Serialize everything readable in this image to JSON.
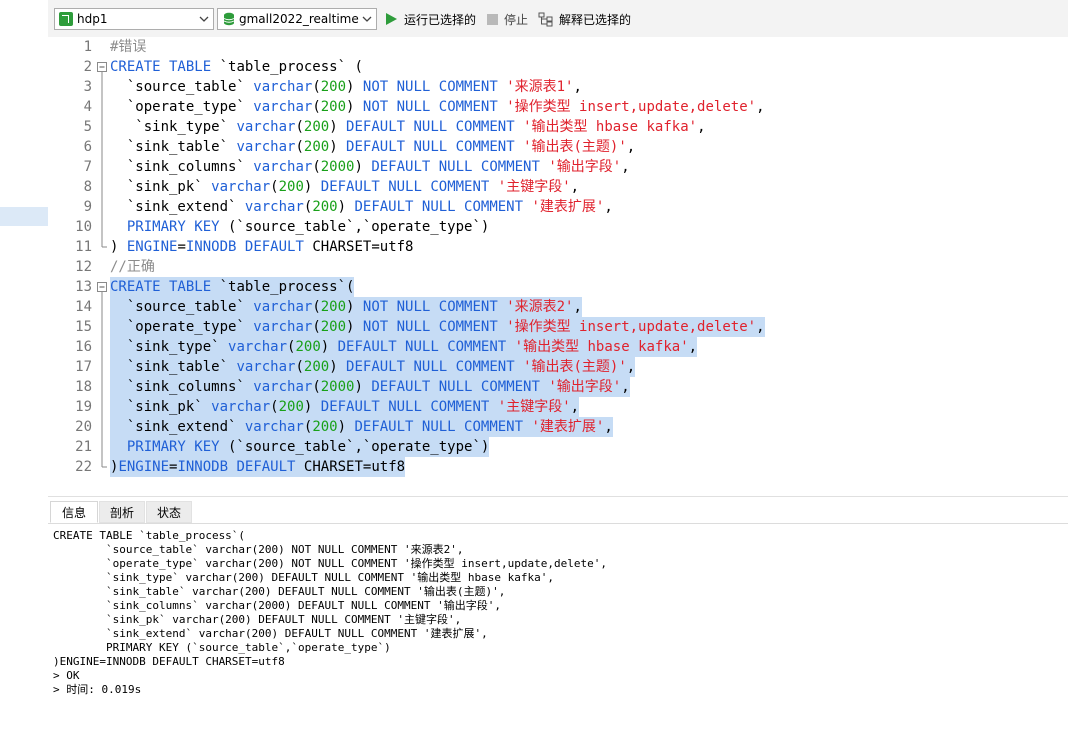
{
  "toolbar": {
    "connection": "hdp1",
    "database": "gmall2022_realtime",
    "run_label": "运行已选择的",
    "stop_label": "停止",
    "explain_label": "解释已选择的",
    "colors": {
      "run": "#2e9c3b",
      "db": "#2e9c3b",
      "connection": "#2e9c3b"
    }
  },
  "editor": {
    "selection_color": "#c6dcf5",
    "lines": [
      {
        "n": "1",
        "tokens": [
          [
            "#错误",
            "cm"
          ]
        ]
      },
      {
        "n": "2",
        "tokens": [
          [
            "CREATE TABLE",
            "kw"
          ],
          [
            " `table_process` (",
            ""
          ]
        ]
      },
      {
        "n": "3",
        "tokens": [
          [
            "  `source_table` ",
            ""
          ],
          [
            "varchar",
            "kw"
          ],
          [
            "(",
            ""
          ],
          [
            "200",
            "num"
          ],
          [
            ") ",
            ""
          ],
          [
            "NOT NULL COMMENT",
            "kw"
          ],
          [
            " ",
            ""
          ],
          [
            "'来源表1'",
            "str"
          ],
          [
            ",",
            ""
          ]
        ]
      },
      {
        "n": "4",
        "tokens": [
          [
            "  `operate_type` ",
            ""
          ],
          [
            "varchar",
            "kw"
          ],
          [
            "(",
            ""
          ],
          [
            "200",
            "num"
          ],
          [
            ") ",
            ""
          ],
          [
            "NOT NULL COMMENT",
            "kw"
          ],
          [
            " ",
            ""
          ],
          [
            "'操作类型 insert,update,delete'",
            "str"
          ],
          [
            ",",
            ""
          ]
        ]
      },
      {
        "n": "5",
        "tokens": [
          [
            "   `sink_type` ",
            ""
          ],
          [
            "varchar",
            "kw"
          ],
          [
            "(",
            ""
          ],
          [
            "200",
            "num"
          ],
          [
            ") ",
            ""
          ],
          [
            "DEFAULT NULL COMMENT",
            "kw"
          ],
          [
            " ",
            ""
          ],
          [
            "'输出类型 hbase kafka'",
            "str"
          ],
          [
            ",",
            ""
          ]
        ]
      },
      {
        "n": "6",
        "tokens": [
          [
            "  `sink_table` ",
            ""
          ],
          [
            "varchar",
            "kw"
          ],
          [
            "(",
            ""
          ],
          [
            "200",
            "num"
          ],
          [
            ") ",
            ""
          ],
          [
            "DEFAULT NULL COMMENT",
            "kw"
          ],
          [
            " ",
            ""
          ],
          [
            "'输出表(主题)'",
            "str"
          ],
          [
            ",",
            ""
          ]
        ]
      },
      {
        "n": "7",
        "tokens": [
          [
            "  `sink_columns` ",
            ""
          ],
          [
            "varchar",
            "kw"
          ],
          [
            "(",
            ""
          ],
          [
            "2000",
            "num"
          ],
          [
            ") ",
            ""
          ],
          [
            "DEFAULT NULL COMMENT",
            "kw"
          ],
          [
            " ",
            ""
          ],
          [
            "'输出字段'",
            "str"
          ],
          [
            ",",
            ""
          ]
        ]
      },
      {
        "n": "8",
        "tokens": [
          [
            "  `sink_pk` ",
            ""
          ],
          [
            "varchar",
            "kw"
          ],
          [
            "(",
            ""
          ],
          [
            "200",
            "num"
          ],
          [
            ") ",
            ""
          ],
          [
            "DEFAULT NULL COMMENT",
            "kw"
          ],
          [
            " ",
            ""
          ],
          [
            "'主键字段'",
            "str"
          ],
          [
            ",",
            ""
          ]
        ]
      },
      {
        "n": "9",
        "tokens": [
          [
            "  `sink_extend` ",
            ""
          ],
          [
            "varchar",
            "kw"
          ],
          [
            "(",
            ""
          ],
          [
            "200",
            "num"
          ],
          [
            ") ",
            ""
          ],
          [
            "DEFAULT NULL COMMENT",
            "kw"
          ],
          [
            " ",
            ""
          ],
          [
            "'建表扩展'",
            "str"
          ],
          [
            ",",
            ""
          ]
        ]
      },
      {
        "n": "10",
        "tokens": [
          [
            "  ",
            ""
          ],
          [
            "PRIMARY KEY",
            "kw"
          ],
          [
            " (`source_table`,`operate_type`)",
            ""
          ]
        ]
      },
      {
        "n": "11",
        "tokens": [
          [
            ") ",
            ""
          ],
          [
            "ENGINE",
            "kw"
          ],
          [
            "=",
            ""
          ],
          [
            "INNODB",
            "kw"
          ],
          [
            " ",
            ""
          ],
          [
            "DEFAULT",
            "kw"
          ],
          [
            " CHARSET=utf8",
            ""
          ]
        ]
      },
      {
        "n": "12",
        "tokens": [
          [
            "//正确",
            "cm"
          ]
        ]
      },
      {
        "n": "13",
        "tokens": [
          [
            "CREATE TABLE",
            "kw"
          ],
          [
            " `table_process`(",
            ""
          ]
        ]
      },
      {
        "n": "14",
        "tokens": [
          [
            "  `source_table` ",
            ""
          ],
          [
            "varchar",
            "kw"
          ],
          [
            "(",
            ""
          ],
          [
            "200",
            "num"
          ],
          [
            ") ",
            ""
          ],
          [
            "NOT NULL COMMENT",
            "kw"
          ],
          [
            " ",
            ""
          ],
          [
            "'来源表2'",
            "str"
          ],
          [
            ",",
            ""
          ]
        ]
      },
      {
        "n": "15",
        "tokens": [
          [
            "  `operate_type` ",
            ""
          ],
          [
            "varchar",
            "kw"
          ],
          [
            "(",
            ""
          ],
          [
            "200",
            "num"
          ],
          [
            ") ",
            ""
          ],
          [
            "NOT NULL COMMENT",
            "kw"
          ],
          [
            " ",
            ""
          ],
          [
            "'操作类型 insert,update,delete'",
            "str"
          ],
          [
            ",",
            ""
          ]
        ]
      },
      {
        "n": "16",
        "tokens": [
          [
            "  `sink_type` ",
            ""
          ],
          [
            "varchar",
            "kw"
          ],
          [
            "(",
            ""
          ],
          [
            "200",
            "num"
          ],
          [
            ") ",
            ""
          ],
          [
            "DEFAULT NULL COMMENT",
            "kw"
          ],
          [
            " ",
            ""
          ],
          [
            "'输出类型 hbase kafka'",
            "str"
          ],
          [
            ",",
            ""
          ]
        ]
      },
      {
        "n": "17",
        "tokens": [
          [
            "  `sink_table` ",
            ""
          ],
          [
            "varchar",
            "kw"
          ],
          [
            "(",
            ""
          ],
          [
            "200",
            "num"
          ],
          [
            ") ",
            ""
          ],
          [
            "DEFAULT NULL COMMENT",
            "kw"
          ],
          [
            " ",
            ""
          ],
          [
            "'输出表(主题)'",
            "str"
          ],
          [
            ",",
            ""
          ]
        ]
      },
      {
        "n": "18",
        "tokens": [
          [
            "  `sink_columns` ",
            ""
          ],
          [
            "varchar",
            "kw"
          ],
          [
            "(",
            ""
          ],
          [
            "2000",
            "num"
          ],
          [
            ") ",
            ""
          ],
          [
            "DEFAULT NULL COMMENT",
            "kw"
          ],
          [
            " ",
            ""
          ],
          [
            "'输出字段'",
            "str"
          ],
          [
            ",",
            ""
          ]
        ]
      },
      {
        "n": "19",
        "tokens": [
          [
            "  `sink_pk` ",
            ""
          ],
          [
            "varchar",
            "kw"
          ],
          [
            "(",
            ""
          ],
          [
            "200",
            "num"
          ],
          [
            ") ",
            ""
          ],
          [
            "DEFAULT NULL COMMENT",
            "kw"
          ],
          [
            " ",
            ""
          ],
          [
            "'主键字段'",
            "str"
          ],
          [
            ",",
            ""
          ]
        ]
      },
      {
        "n": "20",
        "tokens": [
          [
            "  `sink_extend` ",
            ""
          ],
          [
            "varchar",
            "kw"
          ],
          [
            "(",
            ""
          ],
          [
            "200",
            "num"
          ],
          [
            ") ",
            ""
          ],
          [
            "DEFAULT NULL COMMENT",
            "kw"
          ],
          [
            " ",
            ""
          ],
          [
            "'建表扩展'",
            "str"
          ],
          [
            ",",
            ""
          ]
        ]
      },
      {
        "n": "21",
        "tokens": [
          [
            "  ",
            ""
          ],
          [
            "PRIMARY KEY",
            "kw"
          ],
          [
            " (`source_table`,`operate_type`)",
            ""
          ]
        ]
      },
      {
        "n": "22",
        "tokens": [
          [
            ")",
            ""
          ],
          [
            "ENGINE",
            "kw"
          ],
          [
            "=",
            ""
          ],
          [
            "INNODB",
            "kw"
          ],
          [
            " ",
            ""
          ],
          [
            "DEFAULT",
            "kw"
          ],
          [
            " CHARSET=utf8",
            ""
          ]
        ]
      }
    ]
  },
  "results": {
    "tabs": [
      "信息",
      "剖析",
      "状态"
    ],
    "output_lines": [
      "CREATE TABLE `table_process`(",
      "        `source_table` varchar(200) NOT NULL COMMENT '来源表2',",
      "        `operate_type` varchar(200) NOT NULL COMMENT '操作类型 insert,update,delete',",
      "        `sink_type` varchar(200) DEFAULT NULL COMMENT '输出类型 hbase kafka',",
      "        `sink_table` varchar(200) DEFAULT NULL COMMENT '输出表(主题)',",
      "        `sink_columns` varchar(2000) DEFAULT NULL COMMENT '输出字段',",
      "        `sink_pk` varchar(200) DEFAULT NULL COMMENT '主键字段',",
      "        `sink_extend` varchar(200) DEFAULT NULL COMMENT '建表扩展',",
      "        PRIMARY KEY (`source_table`,`operate_type`)",
      ")ENGINE=INNODB DEFAULT CHARSET=utf8",
      "> OK",
      "> 时间: 0.019s"
    ]
  }
}
